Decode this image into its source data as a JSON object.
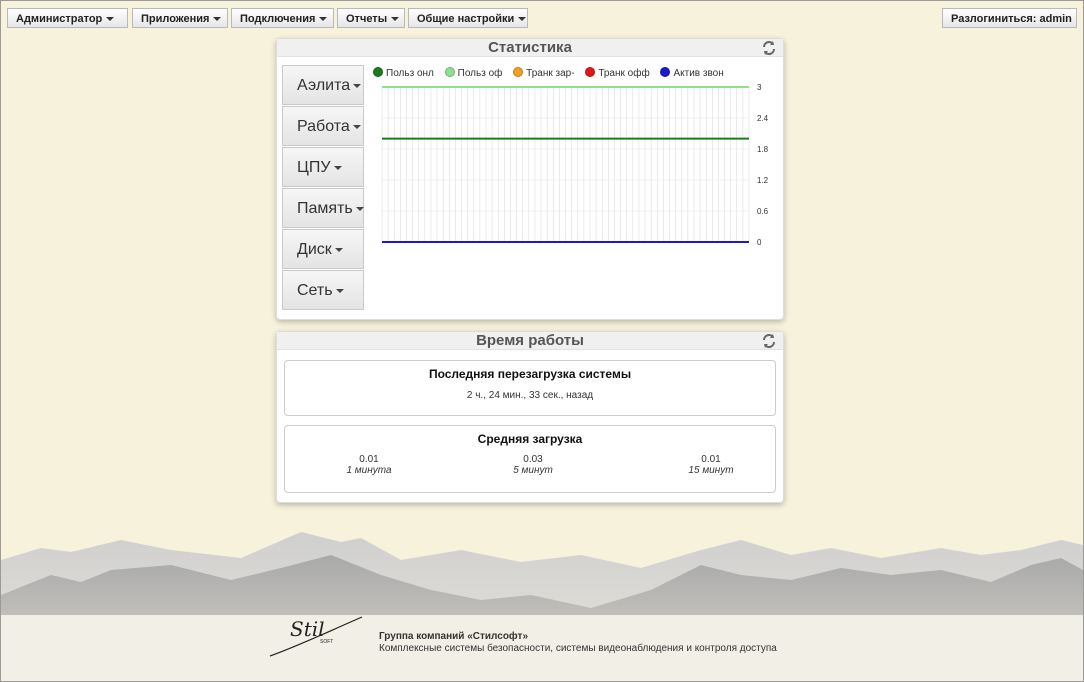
{
  "menu": {
    "admin": "Администратор",
    "apps": "Приложения",
    "connections": "Подключения",
    "reports": "Отчеты",
    "settings": "Общие настройки",
    "logout": "Разлогиниться: admin"
  },
  "stats": {
    "title": "Статистика",
    "side_buttons": [
      "Аэлита",
      "Работа",
      "ЦПУ",
      "Память",
      "Диск",
      "Сеть"
    ],
    "legend": [
      {
        "label": "Польз онл",
        "color": "#1a7d1a"
      },
      {
        "label": "Польз оф",
        "color": "#8fe08f"
      },
      {
        "label": "Транк зар-",
        "color": "#f0a020"
      },
      {
        "label": "Транк офф",
        "color": "#e01818"
      },
      {
        "label": "Актив звон",
        "color": "#1a1acc"
      }
    ]
  },
  "chart_data": {
    "type": "line",
    "ylim": [
      0,
      3
    ],
    "yticks": [
      "3",
      "2.4",
      "1.8",
      "1.2",
      "0.6",
      "0"
    ],
    "series": [
      {
        "name": "Польз онл",
        "color": "#1a7d1a",
        "values": [
          2,
          2
        ]
      },
      {
        "name": "Польз оф",
        "color": "#8fe08f",
        "values": [
          3,
          3
        ]
      },
      {
        "name": "Транк зар-",
        "color": "#f0a020",
        "values": [
          0,
          0
        ]
      },
      {
        "name": "Транк офф",
        "color": "#e01818",
        "values": [
          0,
          0
        ]
      },
      {
        "name": "Актив звон",
        "color": "#1a1acc",
        "values": [
          0,
          0
        ]
      }
    ]
  },
  "uptime": {
    "title": "Время работы",
    "last_reboot_title": "Последняя перезагрузка системы",
    "last_reboot_value": "2 ч., 24 мин., 33 сек., назад",
    "load_title": "Средняя загрузка",
    "loads": [
      {
        "value": "0.01",
        "label": "1 минута"
      },
      {
        "value": "0.03",
        "label": "5 минут"
      },
      {
        "value": "0.01",
        "label": "15 минут"
      }
    ]
  },
  "footer": {
    "company": "Группа компаний «Стилсофт»",
    "tagline": "Комплексные системы безопасности, системы видеонаблюдения и контроля доступа",
    "logo_text": "Stilsoft"
  },
  "icons": {
    "refresh": "refresh-icon",
    "caret": "caret-down-icon"
  }
}
